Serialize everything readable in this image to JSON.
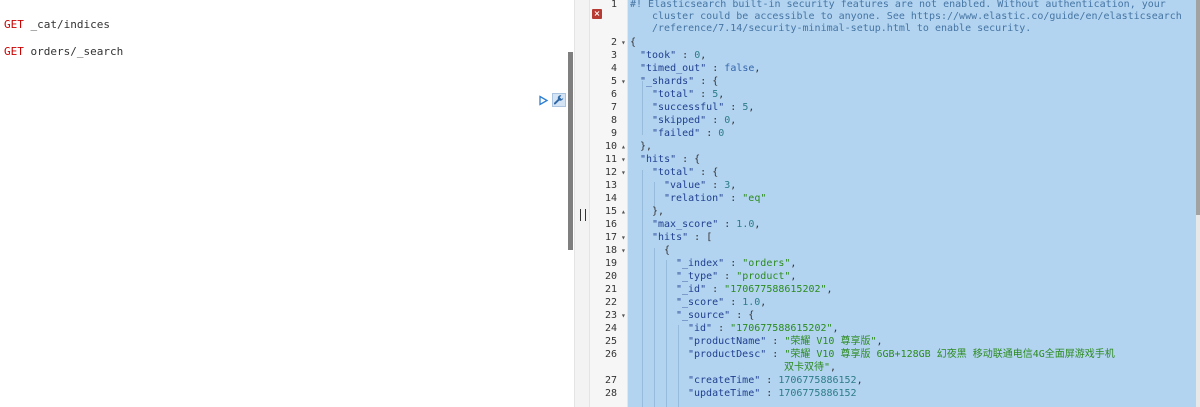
{
  "left_requests": [
    {
      "method": "GET",
      "path": "_cat/indices"
    },
    {
      "method": "GET",
      "path": "orders/_search"
    }
  ],
  "icons": {
    "run": "play-icon",
    "settings": "wrench-icon",
    "error": "error-icon"
  },
  "line_numbers": [
    "1",
    "2",
    "3",
    "4",
    "5",
    "6",
    "7",
    "8",
    "9",
    "10",
    "11",
    "12",
    "13",
    "14",
    "15",
    "16",
    "17",
    "18",
    "19",
    "20",
    "21",
    "22",
    "23",
    "24",
    "25",
    "26",
    "27",
    "28"
  ],
  "output_lines": {
    "comment_1": "#! Elasticsearch built-in security features are not enabled. Without authentication, your",
    "comment_2": "cluster could be accessible to anyone. See https://www.elastic.co/guide/en/elasticsearch",
    "comment_3": "/reference/7.14/security-minimal-setup.html to enable security.",
    "open_brace": "{",
    "took_key": "\"took\"",
    "took_value": "0",
    "timed_out_key": "\"timed_out\"",
    "timed_out_value": "false",
    "shards_key": "\"_shards\"",
    "total_key": "\"total\"",
    "total_value": "5",
    "successful_key": "\"successful\"",
    "successful_value": "5",
    "skipped_key": "\"skipped\"",
    "skipped_value": "0",
    "failed_key": "\"failed\"",
    "failed_value": "0",
    "close_object": "},",
    "hits_key": "\"hits\"",
    "hits_total_key": "\"total\"",
    "value_key": "\"value\"",
    "value_value": "3",
    "relation_key": "\"relation\"",
    "relation_value": "\"eq\"",
    "max_score_key": "\"max_score\"",
    "max_score_value": "1.0",
    "hits_array_key": "\"hits\"",
    "open_bracket": "[",
    "open_object": "{",
    "index_key": "\"_index\"",
    "index_value": "\"orders\"",
    "type_key": "\"_type\"",
    "type_value": "\"product\"",
    "id_key": "\"_id\"",
    "id_value": "\"170677588615202\"",
    "score_key": "\"_score\"",
    "score_value": "1.0",
    "source_key": "\"_source\"",
    "source_id_key": "\"id\"",
    "source_id_value": "\"170677588615202\"",
    "product_name_key": "\"productName\"",
    "product_name_value": "\"荣耀 V10 尊享版\"",
    "product_desc_key": "\"productDesc\"",
    "product_desc_value_1": "\"荣耀 V10 尊享版 6GB+128GB 幻夜黑 移动联通电信4G全面屏游戏手机",
    "product_desc_value_2": "双卡双待\"",
    "create_time_key": "\"createTime\"",
    "create_time_value": "1706775886152",
    "update_time_key": "\"updateTime\"",
    "update_time_value": "1706775886152"
  }
}
